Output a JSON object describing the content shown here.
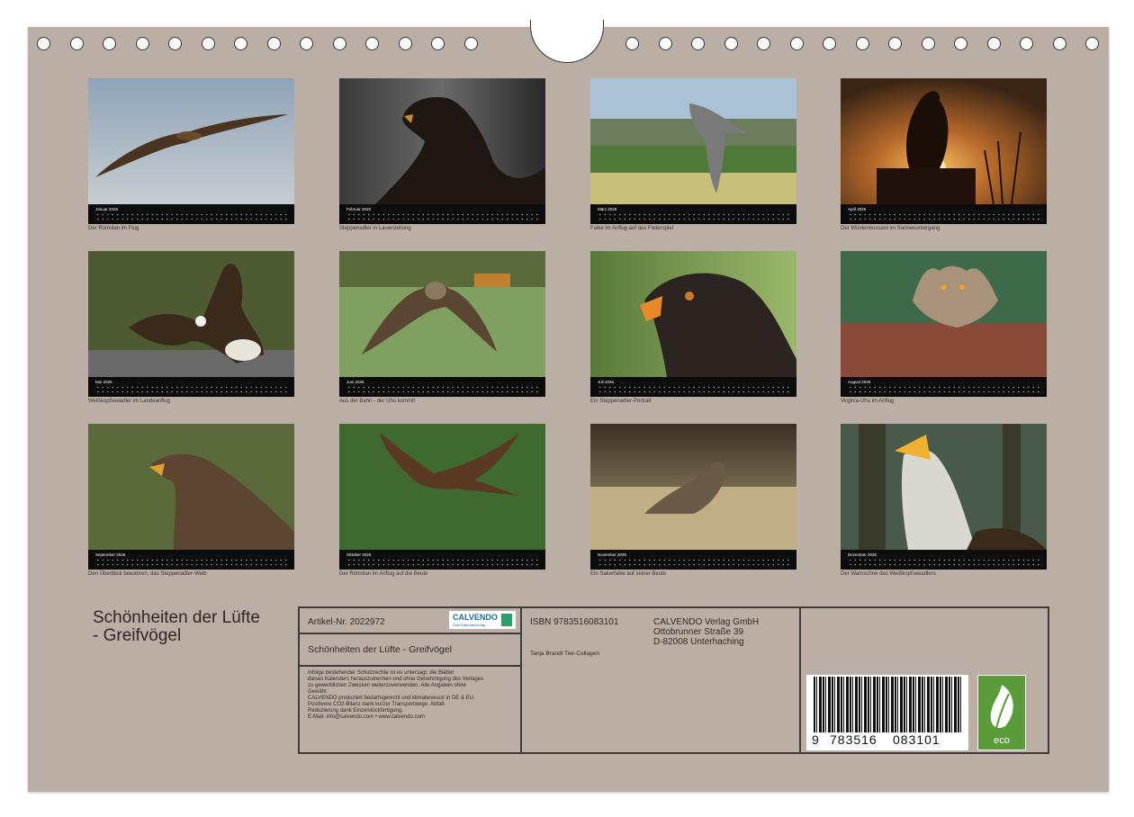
{
  "months": [
    {
      "month": "Januar 2026",
      "caption": "Der Rotmilan im Flug"
    },
    {
      "month": "Februar 2026",
      "caption": "Steppenadler in Lauerstellung"
    },
    {
      "month": "März 2026",
      "caption": "Falke im Anflug auf das Federspiel"
    },
    {
      "month": "April 2026",
      "caption": "Der Wüstenbussard im Sonnenuntergang"
    },
    {
      "month": "Mai 2026",
      "caption": "Weißkopfseeadler im Landeanflug"
    },
    {
      "month": "Juni 2026",
      "caption": "Aus der Bahn - der Uhu kommt!"
    },
    {
      "month": "Juli 2026",
      "caption": "Ein Steppenadler-Portrait"
    },
    {
      "month": "August 2026",
      "caption": "Virginia-Uhu im Anflug"
    },
    {
      "month": "September 2026",
      "caption": "Den Überblick bewahren, das Steppenadler-Weib"
    },
    {
      "month": "Oktober 2026",
      "caption": "Der Rotmilan im Anflug auf die Beute"
    },
    {
      "month": "November 2026",
      "caption": "Ein Sakerfalke auf seiner Beute"
    },
    {
      "month": "Dezember 2026",
      "caption": "Der Warnschrei des Weißkopfseeadlers"
    }
  ],
  "title": {
    "line1": "Schönheiten der Lüfte",
    "line2": "- Greifvögel"
  },
  "info": {
    "article": "Artikel-Nr. 2022972",
    "logo": "CALVENDO",
    "logo_sub": "Dein Kalenderverlag",
    "title": "Schönheiten der Lüfte - Greifvögel",
    "legal": [
      "Infolge bestehender Schutzrechte ist es untersagt, die Blätter",
      "dieses Kalenders herauszutrennen und ohne Genehmigung des Verlages",
      "zu gewerblichen Zwecken weiterzuverwenden. Alle Angaben ohne",
      "Gewähr.",
      "CALVENDO produziert bedarfsgerecht und klimabewusst in DE & EU.",
      "Positivere CO2-Bilanz dank kurzer Transportwege. Abfall-",
      "Reduzierung dank Einzelstückfertigung.",
      "E-Mail: info@calvendo.com • www.calvendo.com"
    ],
    "isbn": "ISBN 9783516083101",
    "author": "Tanja Brandt Tier-Collagen",
    "publisher": [
      "CALVENDO Verlag GmbH",
      "Ottobrunner Straße 39",
      "D-82008 Unterhaching"
    ],
    "barcode_digits": [
      "9",
      "783516",
      "083101"
    ],
    "eco_label": "eco"
  }
}
